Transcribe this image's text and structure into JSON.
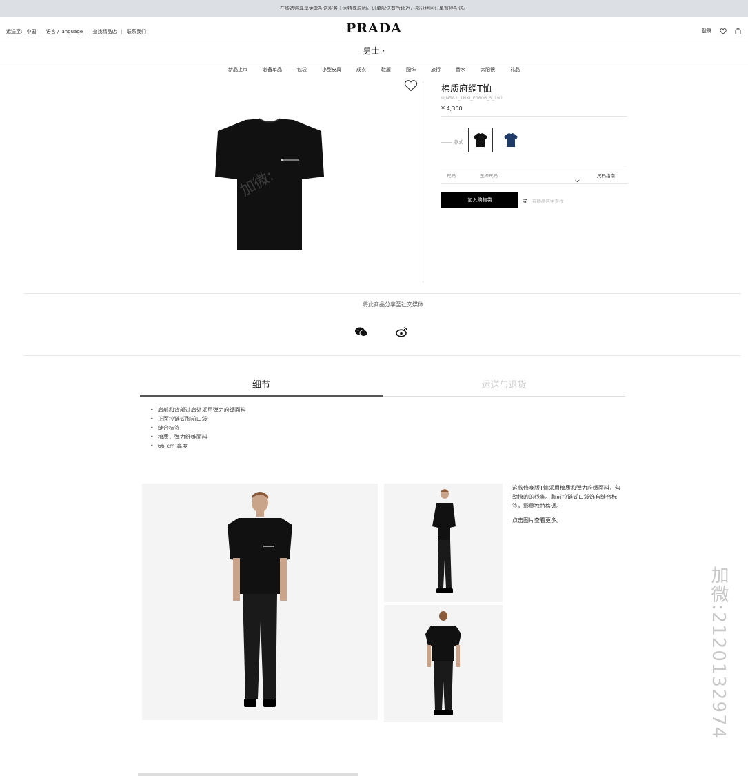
{
  "topbar": {
    "notice": "在线选购尊享免邮配送服务｜因特殊原因，订单配送有所延迟，部分地区订单暂停配送。"
  },
  "header": {
    "ship_to_label": "运送至:",
    "ship_to_value": "中国",
    "language": "语言 / language",
    "store_locator": "查找精品店",
    "contact": "联系我们",
    "logo": "PRADA",
    "login": "登录"
  },
  "section": {
    "title": "男士 ·"
  },
  "nav": {
    "items": [
      "新品上市",
      "必备单品",
      "包袋",
      "小型皮具",
      "成衣",
      "鞋履",
      "配饰",
      "旅行",
      "香水",
      "太阳镜",
      "礼品"
    ]
  },
  "product": {
    "title": "棉质府绸T恤",
    "code": "UJN582_1NXI_F0806_S_192",
    "price": "¥ 4,300",
    "style_label": "款式",
    "size_label": "尺码",
    "size_placeholder": "选择尺码",
    "size_guide": "尺码指南",
    "add_to_bag": "加入购物袋",
    "or": "或",
    "find_in_store": "在精品店中查找"
  },
  "share": {
    "title": "将此商品分享至社交媒体"
  },
  "tabs": {
    "details": "细节",
    "shipping": "运送与退货"
  },
  "details": {
    "items": [
      "肩部和背部过肩处采用弹力府绸面料",
      "正面拉链式胸前口袋",
      "缝合标签",
      "棉质，弹力纤维面料",
      "66 cm 高度"
    ]
  },
  "description": {
    "text": "这款修身版T恤采用棉质和弹力府绸面料，勾勒撩的的线条。胸前拉链式口袋饰有缝合标签，彰显独特格调。",
    "more": "点击图片查看更多。"
  },
  "watermark": {
    "side": "加微:2120132974",
    "image": "加微:"
  },
  "colors": {
    "black": "#111111",
    "navy": "#1f3a66",
    "topbar": "#dcdfe4"
  },
  "icons": [
    "search-icon",
    "heart-icon",
    "bag-icon",
    "wechat-icon",
    "weibo-icon",
    "chevron-down-icon"
  ]
}
